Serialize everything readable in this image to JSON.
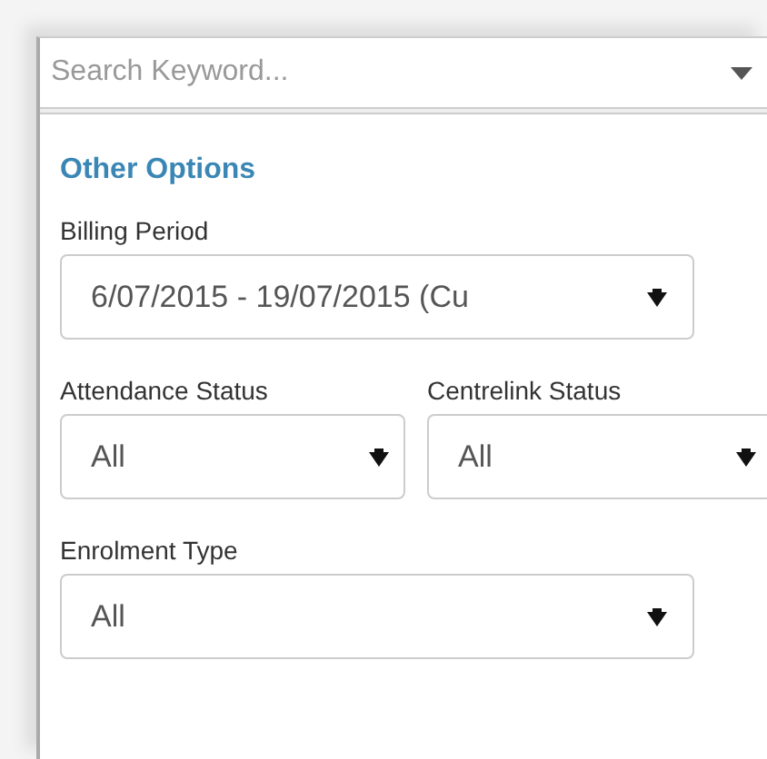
{
  "search": {
    "placeholder": "Search Keyword..."
  },
  "section_title": "Other Options",
  "billing_period": {
    "label": "Billing Period",
    "value": "6/07/2015 - 19/07/2015 (Cu"
  },
  "attendance_status": {
    "label": "Attendance Status",
    "value": "All"
  },
  "centrelink_status": {
    "label": "Centrelink Status",
    "value": "All"
  },
  "enrolment_type": {
    "label": "Enrolment Type",
    "value": "All"
  }
}
